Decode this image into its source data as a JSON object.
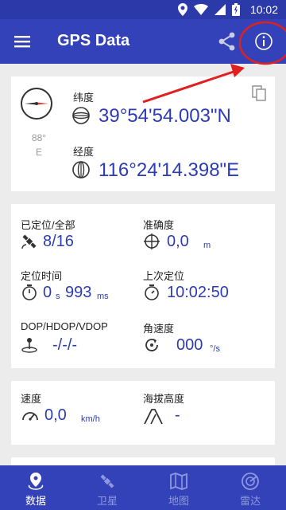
{
  "status_bar": {
    "time": "10:02"
  },
  "app_bar": {
    "title": "GPS Data"
  },
  "compass": {
    "heading": "88°",
    "direction": "E"
  },
  "coordinates": {
    "latitude_label": "纬度",
    "latitude_value": "39°54'54.003\"N",
    "longitude_label": "经度",
    "longitude_value": "116°24'14.398\"E"
  },
  "stats": {
    "fixed_label": "已定位/全部",
    "fixed_value": "8/16",
    "accuracy_label": "准确度",
    "accuracy_value": "0,0",
    "accuracy_unit": "m",
    "fix_time_label": "定位时间",
    "fix_time_seconds": "0",
    "fix_time_s_unit": "s",
    "fix_time_ms": "993",
    "fix_time_ms_unit": "ms",
    "last_fix_label": "上次定位",
    "last_fix_value": "10:02:50",
    "dop_label": "DOP/HDOP/VDOP",
    "dop_value": "-/-/-",
    "angular_speed_label": "角速度",
    "angular_speed_value": "000",
    "angular_speed_unit": "°/s"
  },
  "motion": {
    "speed_label": "速度",
    "speed_value": "0,0",
    "speed_unit": "km/h",
    "altitude_label": "海拔高度",
    "altitude_value": "-"
  },
  "bottom_nav": {
    "items": [
      {
        "label": "数据",
        "icon": "location-pin-icon",
        "active": true
      },
      {
        "label": "卫星",
        "icon": "satellite-icon",
        "active": false
      },
      {
        "label": "地图",
        "icon": "map-icon",
        "active": false
      },
      {
        "label": "雷达",
        "icon": "radar-icon",
        "active": false
      }
    ]
  },
  "colors": {
    "primary": "#3342b8",
    "status_bar": "#2b3aa8",
    "value_blue": "#2d3bb6",
    "annotation_red": "#e02020"
  }
}
